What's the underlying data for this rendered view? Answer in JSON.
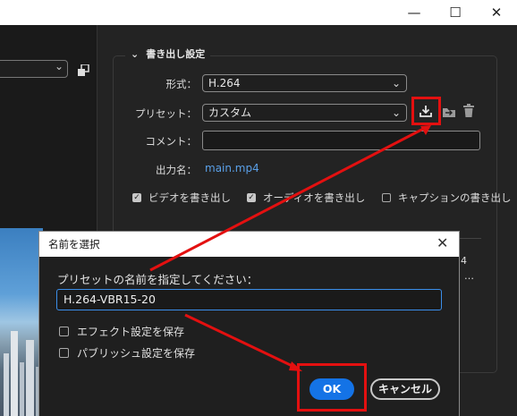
{
  "window": {
    "minimize_icon": "minimize-icon",
    "maximize_icon": "maximize-icon",
    "close_icon": "close-icon"
  },
  "export": {
    "section_title": "書き出し設定",
    "format_label": "形式：",
    "format_value": "H.264",
    "preset_label": "プリセット：",
    "preset_value": "カスタム",
    "comment_label": "コメント：",
    "comment_value": "",
    "output_label": "出力名：",
    "output_value": "main.mp4",
    "export_video": "ビデオを書き出し",
    "export_audio": "オーディオを書き出し",
    "export_captions": "キャプションの書き出し",
    "side_text_1": "4",
    "side_text_2": "…",
    "icons": [
      "save-preset-icon",
      "import-preset-icon",
      "trash-icon"
    ]
  },
  "dialog": {
    "title": "名前を選択",
    "prompt": "プリセットの名前を指定してください：",
    "name_value": "H.264-VBR15-20",
    "save_effects": "エフェクト設定を保存",
    "save_publish": "パブリッシュ設定を保存",
    "ok_label": "OK",
    "cancel_label": "キャンセル"
  },
  "colors": {
    "accent": "#1473e6",
    "annotation": "#e31010",
    "link": "#5aa0e8"
  }
}
